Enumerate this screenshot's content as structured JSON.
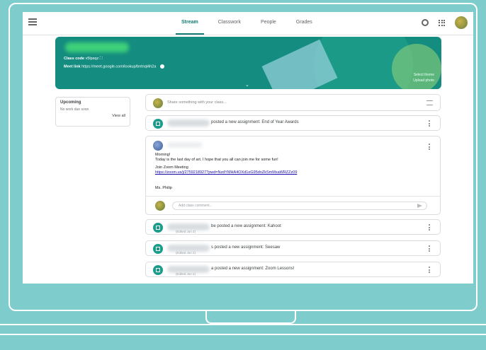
{
  "nav": {
    "tabs": [
      {
        "label": "Stream",
        "active": true
      },
      {
        "label": "Classwork",
        "active": false
      },
      {
        "label": "People",
        "active": false
      },
      {
        "label": "Grades",
        "active": false
      }
    ]
  },
  "banner": {
    "class_code_label": "Class code",
    "class_code": "v5lpsqz",
    "meet_label": "Meet link",
    "meet_url": "https://meet.google.com/lookup/bntnql4h2a",
    "select_theme": "Select theme",
    "upload_photo": "Upload photo"
  },
  "upcoming": {
    "title": "Upcoming",
    "empty": "No work due soon",
    "view_all": "View all"
  },
  "share": {
    "placeholder": "Share something with your class..."
  },
  "assignments": [
    {
      "text": "posted a new assignment: End of Year Awards",
      "date": ""
    },
    {
      "text": "be posted a new assignment: Kahoot",
      "date": "(Edited Jun 2)"
    },
    {
      "text": "s posted a new assignment: Seesaw",
      "date": "(Edited Jun 2)"
    },
    {
      "text": "a posted a new assignment: Zoom Lessons!",
      "date": "(Edited Jun 2)"
    }
  ],
  "post": {
    "line1": "Morning!",
    "line2": "Today is the last day of art. I hope that you all can join me for some fun!",
    "zoom_label": "Join Zoom Meeting",
    "zoom_link": "https://zoom.us/j/2759218927?pwd=NzdYMHA4OXd1eG95dnZkSmMxaWRZZz09",
    "signature": "Ms. Philip",
    "comment_placeholder": "Add class comment..."
  },
  "colors": {
    "accent": "#127c75",
    "banner": "#148c7f",
    "frame": "#7fcccc"
  }
}
